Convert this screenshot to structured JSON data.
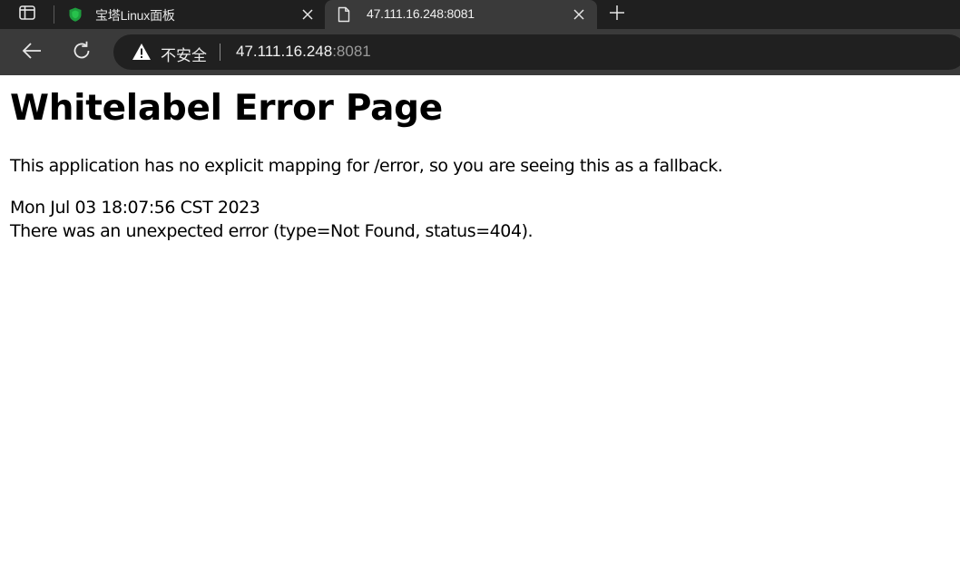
{
  "browser": {
    "tabs": [
      {
        "title": "宝塔Linux面板",
        "favicon": "baota-shield-icon",
        "active": false
      },
      {
        "title": "47.111.16.248:8081",
        "favicon": "document-icon",
        "active": true
      }
    ],
    "toolbar": {
      "security_label": "不安全",
      "url_host": "47.111.16.248",
      "url_port": ":8081"
    }
  },
  "page": {
    "title": "Whitelabel Error Page",
    "message": "This application has no explicit mapping for /error, so you are seeing this as a fallback.",
    "timestamp": "Mon Jul 03 18:07:56 CST 2023",
    "error_detail": "There was an unexpected error (type=Not Found, status=404)."
  },
  "colors": {
    "tabstrip_bg": "#1f1f1f",
    "active_tab_bg": "#3a3a3a",
    "omnibox_bg": "#202020",
    "favicon_green": "#1e9e3e"
  }
}
